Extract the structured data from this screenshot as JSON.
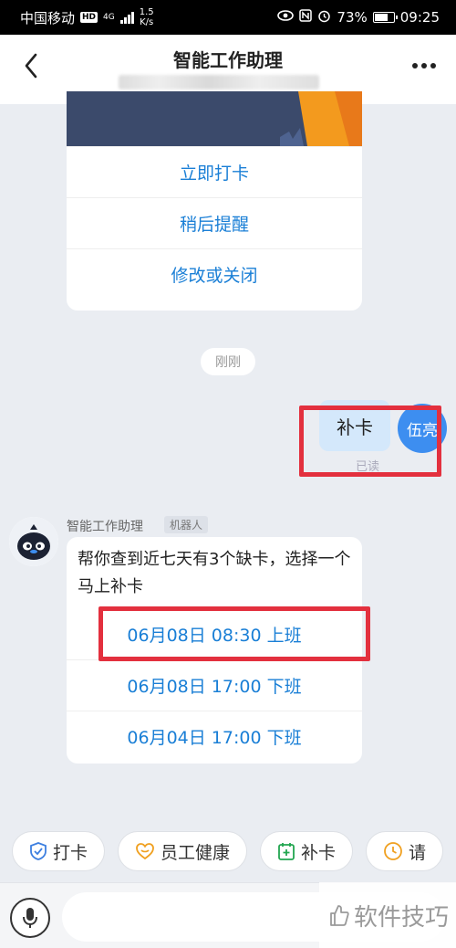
{
  "status_bar": {
    "carrier": "中国移动",
    "hd": "HD",
    "network": "4G",
    "speed_value": "1.5",
    "speed_unit": "K/s",
    "battery": "73%",
    "time": "09:25"
  },
  "header": {
    "title": "智能工作助理"
  },
  "card_top": {
    "actions": [
      "立即打卡",
      "稍后提醒",
      "修改或关闭"
    ]
  },
  "time_divider": "刚刚",
  "outgoing": {
    "text": "补卡",
    "avatar_text": "伍亮",
    "read_status": "已读"
  },
  "bot": {
    "name": "智能工作助理",
    "tag": "机器人",
    "message": "帮你查到近七天有3个缺卡，选择一个马上补卡",
    "options": [
      "06月08日 08:30 上班",
      "06月08日 17:00 下班",
      "06月04日 17:00 下班"
    ]
  },
  "quick_actions": [
    {
      "label": "打卡",
      "icon": "check-shield-icon"
    },
    {
      "label": "员工健康",
      "icon": "heart-icon"
    },
    {
      "label": "补卡",
      "icon": "calendar-plus-icon"
    },
    {
      "label": "请",
      "icon": "clock-icon"
    }
  ],
  "colors": {
    "accent": "#1a7fd6",
    "highlight": "#e3303e",
    "bubble": "#d4e8fb",
    "avatar": "#3d8ef0"
  },
  "watermark": "软件技巧"
}
